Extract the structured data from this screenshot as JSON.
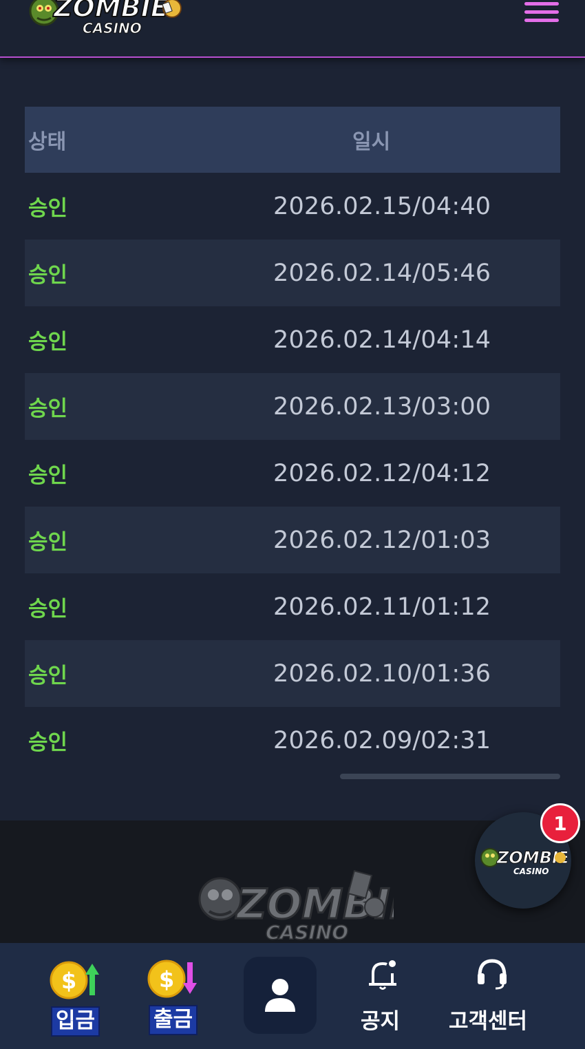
{
  "header": {
    "logo_text": "ZOMBIE",
    "logo_sub": "CASINO"
  },
  "table": {
    "headers": {
      "status": "상태",
      "date": "일시"
    },
    "rows": [
      {
        "status": "승인",
        "date": "2026.02.15/04:40"
      },
      {
        "status": "승인",
        "date": "2026.02.14/05:46"
      },
      {
        "status": "승인",
        "date": "2026.02.14/04:14"
      },
      {
        "status": "승인",
        "date": "2026.02.13/03:00"
      },
      {
        "status": "승인",
        "date": "2026.02.12/04:12"
      },
      {
        "status": "승인",
        "date": "2026.02.12/01:03"
      },
      {
        "status": "승인",
        "date": "2026.02.11/01:12"
      },
      {
        "status": "승인",
        "date": "2026.02.10/01:36"
      },
      {
        "status": "승인",
        "date": "2026.02.09/02:31"
      }
    ]
  },
  "fab": {
    "badge_count": "1"
  },
  "bottom_nav": {
    "deposit": "입금",
    "withdraw": "출금",
    "notice": "공지",
    "support": "고객센터"
  },
  "colors": {
    "accent": "#e36ee8",
    "approved": "#6fd64d",
    "badge": "#e8203c"
  },
  "icons": [
    "menu-icon",
    "user-icon",
    "bell-icon",
    "headset-icon",
    "coin-up-icon",
    "coin-down-icon"
  ]
}
